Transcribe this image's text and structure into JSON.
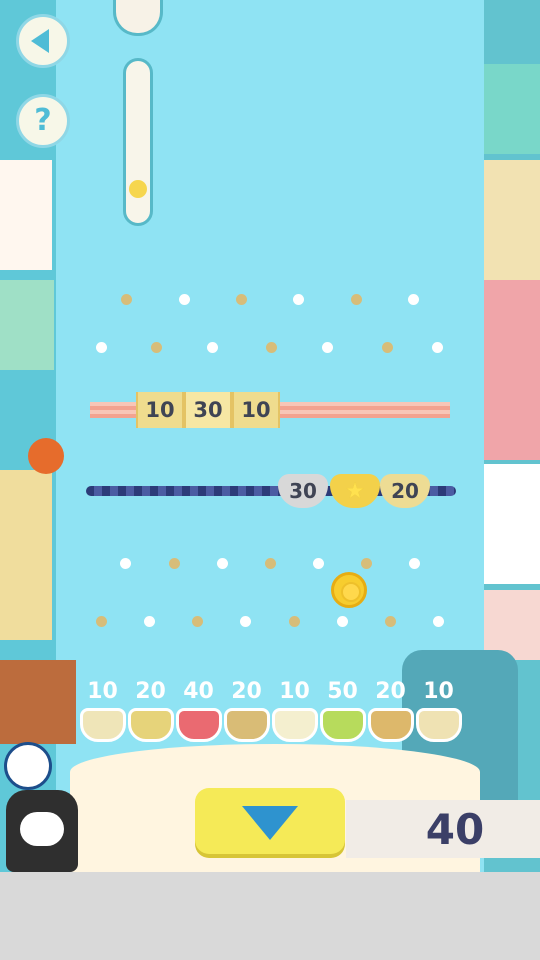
{
  "buttons": {
    "back_icon": "back-icon",
    "help_icon": "help-icon"
  },
  "bars": {
    "stripe_labels": [
      "10",
      "30",
      "10"
    ],
    "rope_cups": [
      {
        "label": "30",
        "color": "#d8d8d8"
      },
      {
        "label": "star",
        "color": "#f3d14a"
      },
      {
        "label": "20",
        "color": "#eddc94"
      }
    ]
  },
  "slots": [
    {
      "value": "10",
      "color": "#efe5b8"
    },
    {
      "value": "20",
      "color": "#e6d37a"
    },
    {
      "value": "40",
      "color": "#ea6a71"
    },
    {
      "value": "20",
      "color": "#d9bc76"
    },
    {
      "value": "10",
      "color": "#f4efcf"
    },
    {
      "value": "50",
      "color": "#b7db5c"
    },
    {
      "value": "20",
      "color": "#ddb86b"
    },
    {
      "value": "10",
      "color": "#efe2b3"
    }
  ],
  "controls": {
    "drop_icon": "down-arrow-icon",
    "score": "40"
  }
}
